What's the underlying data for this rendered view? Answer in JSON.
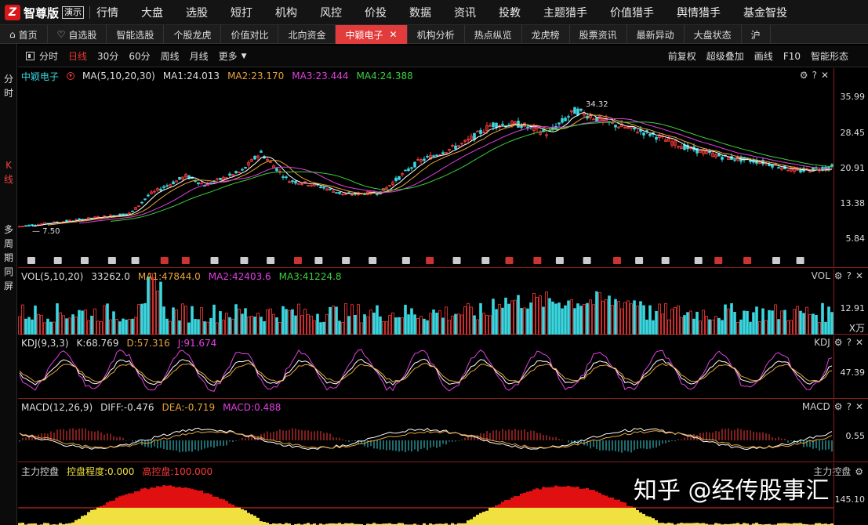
{
  "app": {
    "logo_char": "Z",
    "name": "智尊版",
    "edition": "演示"
  },
  "menu": [
    "行情",
    "大盘",
    "选股",
    "短打",
    "机构",
    "风控",
    "价投",
    "数据",
    "资讯",
    "投教",
    "主题猎手",
    "价值猎手",
    "舆情猎手",
    "基金智投"
  ],
  "tabs": [
    {
      "label": "首页",
      "icon": "home-icon"
    },
    {
      "label": "自选股",
      "icon": "heart-icon"
    },
    {
      "label": "智能选股"
    },
    {
      "label": "个股龙虎"
    },
    {
      "label": "价值对比"
    },
    {
      "label": "北向资金"
    },
    {
      "label": "中颖电子",
      "active": true,
      "closable": true
    },
    {
      "label": "机构分析"
    },
    {
      "label": "热点纵览"
    },
    {
      "label": "龙虎榜"
    },
    {
      "label": "股票资讯"
    },
    {
      "label": "最新异动"
    },
    {
      "label": "大盘状态"
    },
    {
      "label": "沪"
    }
  ],
  "left_labels": {
    "time_share": "分时",
    "kline": "K线",
    "multi_period": "多周期同屏"
  },
  "toolbar": {
    "left": [
      "分时",
      "日线",
      "30分",
      "60分",
      "周线",
      "月线",
      "更多"
    ],
    "active": "日线",
    "right": [
      "前复权",
      "超级叠加",
      "画线",
      "F10",
      "智能形态"
    ]
  },
  "kline": {
    "stock_name": "中颖电子",
    "ma_params": "MA(5,10,20,30)",
    "ma1": "MA1:24.013",
    "ma2": "MA2:23.170",
    "ma3": "MA3:23.444",
    "ma4": "MA4:24.388",
    "y_labels": [
      "35.99",
      "28.45",
      "20.91",
      "13.38",
      "5.84"
    ],
    "high_label": "34.32",
    "low_label": "7.50"
  },
  "volume": {
    "params": "VOL(5,10,20)",
    "value": "33262.0",
    "ma1": "MA1:47844.0",
    "ma2": "MA2:42403.6",
    "ma3": "MA3:41224.8",
    "tag": "VOL",
    "y_label": "12.91",
    "unit": "X万"
  },
  "kdj": {
    "params": "KDJ(9,3,3)",
    "k": "K:68.769",
    "d": "D:57.316",
    "j": "J:91.674",
    "tag": "KDJ",
    "y_label": "47.39"
  },
  "macd": {
    "params": "MACD(12,26,9)",
    "diff": "DIFF:-0.476",
    "dea": "DEA:-0.719",
    "macd": "MACD:0.488",
    "tag": "MACD",
    "y_label": "0.55"
  },
  "control": {
    "name": "主力控盘",
    "degree": "控盘程度:0.000",
    "high": "高控盘:100.000",
    "tag": "主力控盘",
    "y_label": "145.10"
  },
  "watermark": "知乎 @经传股事汇",
  "colors": {
    "up": "#ff3b3b",
    "down": "#3ad7e0",
    "ma1": "#ffffff",
    "ma2": "#e8a33a",
    "ma3": "#e040e0",
    "ma4": "#3bd13b",
    "active_tab": "#e23b3b"
  }
}
